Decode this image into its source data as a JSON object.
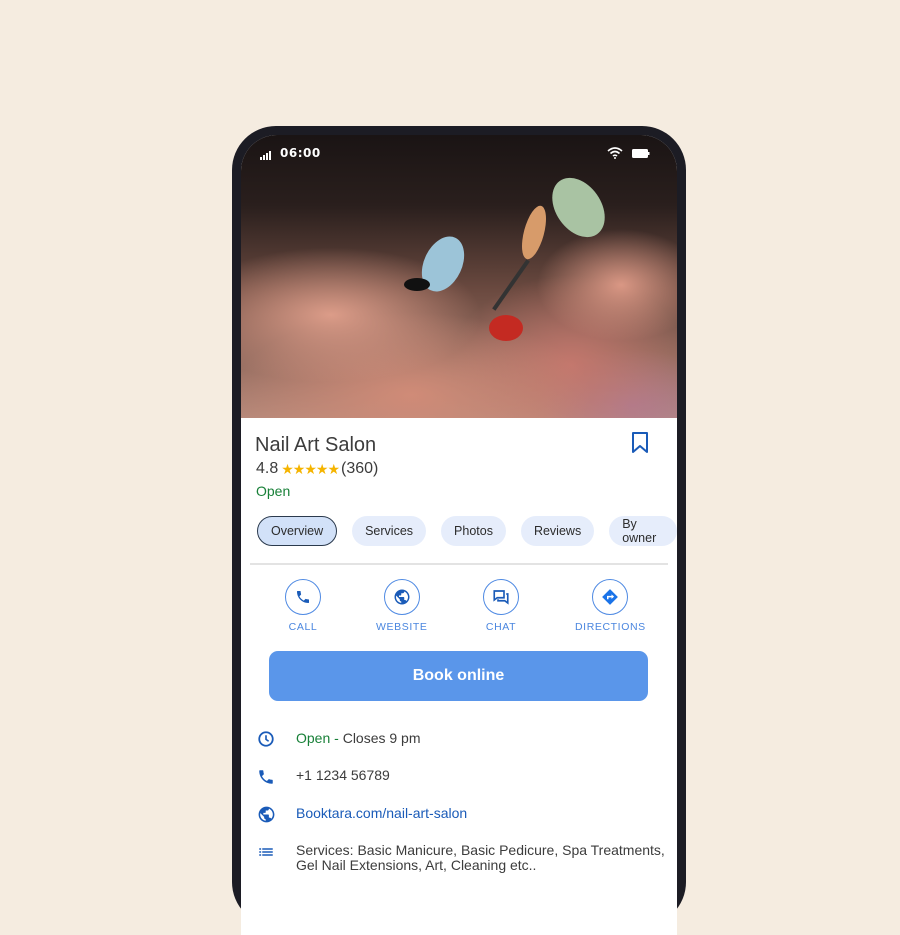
{
  "status_bar": {
    "time": "06:00"
  },
  "place": {
    "name": "Nail Art Salon",
    "rating": "4.8",
    "stars": "★★★★★",
    "review_count": "(360)",
    "open_status": "Open"
  },
  "tabs": [
    {
      "label": "Overview",
      "active": true
    },
    {
      "label": "Services",
      "active": false
    },
    {
      "label": "Photos",
      "active": false
    },
    {
      "label": "Reviews",
      "active": false
    },
    {
      "label": "By owner",
      "active": false
    }
  ],
  "actions": [
    {
      "label": "CALL",
      "icon": "phone-icon"
    },
    {
      "label": "WEBSITE",
      "icon": "globe-icon"
    },
    {
      "label": "CHAT",
      "icon": "chat-icon"
    },
    {
      "label": "DIRECTIONS",
      "icon": "directions-icon"
    }
  ],
  "book_button": {
    "label": "Book online"
  },
  "info": {
    "hours": {
      "status": "Open",
      "separator": " - ",
      "closes": "Closes 9 pm"
    },
    "phone": "+1 1234 56789",
    "website": "Booktara.com/nail-art-salon",
    "services_line1": "Services: Basic Manicure, Basic Pedicure, Spa Treatments,",
    "services_line2": "Gel Nail Extensions, Art, Cleaning etc.."
  },
  "colors": {
    "accent": "#5a96ea",
    "icon_blue": "#1a5bb8",
    "open_green": "#188038",
    "star": "#f5b400",
    "background": "#f5ece0"
  }
}
